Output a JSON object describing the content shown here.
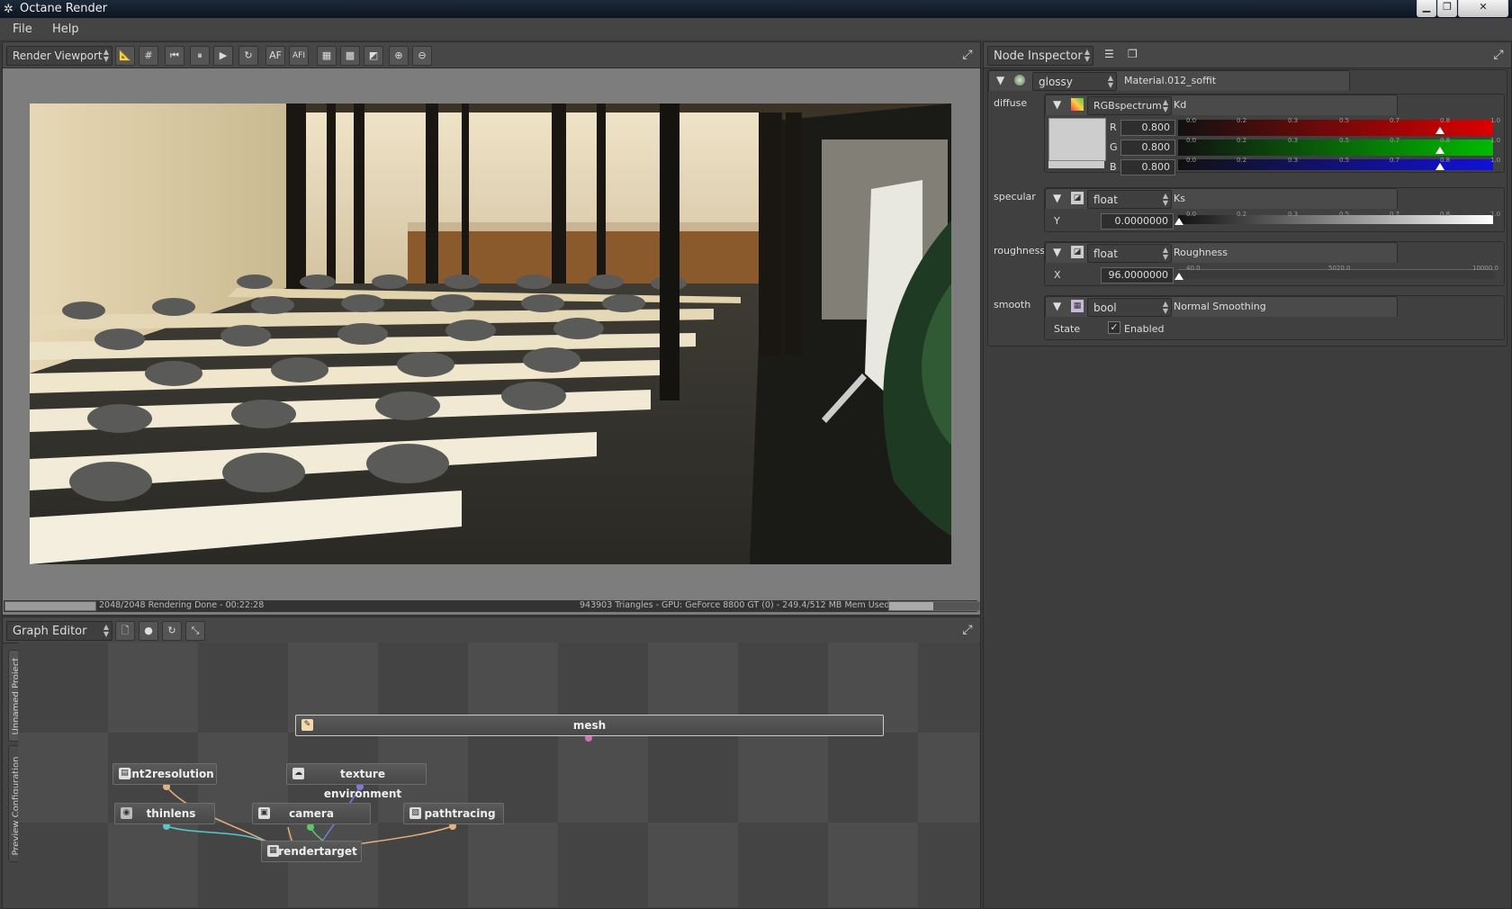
{
  "window": {
    "title": "Octane Render",
    "minimize_icon": "minimize-icon",
    "restore_icon": "restore-icon",
    "close_icon": "close-icon"
  },
  "menu": {
    "file": "File",
    "help": "Help"
  },
  "viewport": {
    "selector": "Render Viewport",
    "toolbar_af": "AF",
    "toolbar_afi": "AFI",
    "status_left": "2048/2048 Rendering Done - 00:22:28",
    "status_right": "943903 Triangles - GPU: GeForce 8800 GT (0) - 249.4/512 MB Mem Used",
    "progress": 1.0,
    "mem_fraction": 0.49
  },
  "graph": {
    "selector": "Graph Editor",
    "side_tabs": [
      "Unnamed Project",
      "Preview Configuration"
    ],
    "nodes": {
      "mesh": "mesh",
      "int2resolution": "int2resolution",
      "texture_environment": "texture environment",
      "thinlens": "thinlens",
      "camera": "camera",
      "pathtracing": "pathtracing",
      "rendertarget": "rendertarget"
    }
  },
  "inspector": {
    "selector": "Node Inspector",
    "material_type": "glossy",
    "material_name": "Material.012_soffit",
    "params": {
      "diffuse": {
        "label": "diffuse",
        "type": "RGBspectrum",
        "name": "Kd",
        "r_label": "R",
        "g_label": "G",
        "b_label": "B",
        "r": "0.800",
        "g": "0.800",
        "b": "0.800"
      },
      "specular": {
        "label": "specular",
        "type": "float",
        "name": "Ks",
        "axis": "Y",
        "value": "0.0000000"
      },
      "roughness": {
        "label": "roughness",
        "type": "float",
        "name": "Roughness",
        "axis": "X",
        "value": "96.0000000"
      },
      "smooth": {
        "label": "smooth",
        "type": "bool",
        "name": "Normal Smoothing",
        "state_label": "State",
        "state_value": "Enabled"
      }
    },
    "scale_01": [
      "0.0",
      "0.2",
      "0.3",
      "0.5",
      "0.7",
      "0.8",
      "1.0"
    ],
    "scale_rough": [
      "40.0",
      "5020.0",
      "10000.0"
    ]
  }
}
